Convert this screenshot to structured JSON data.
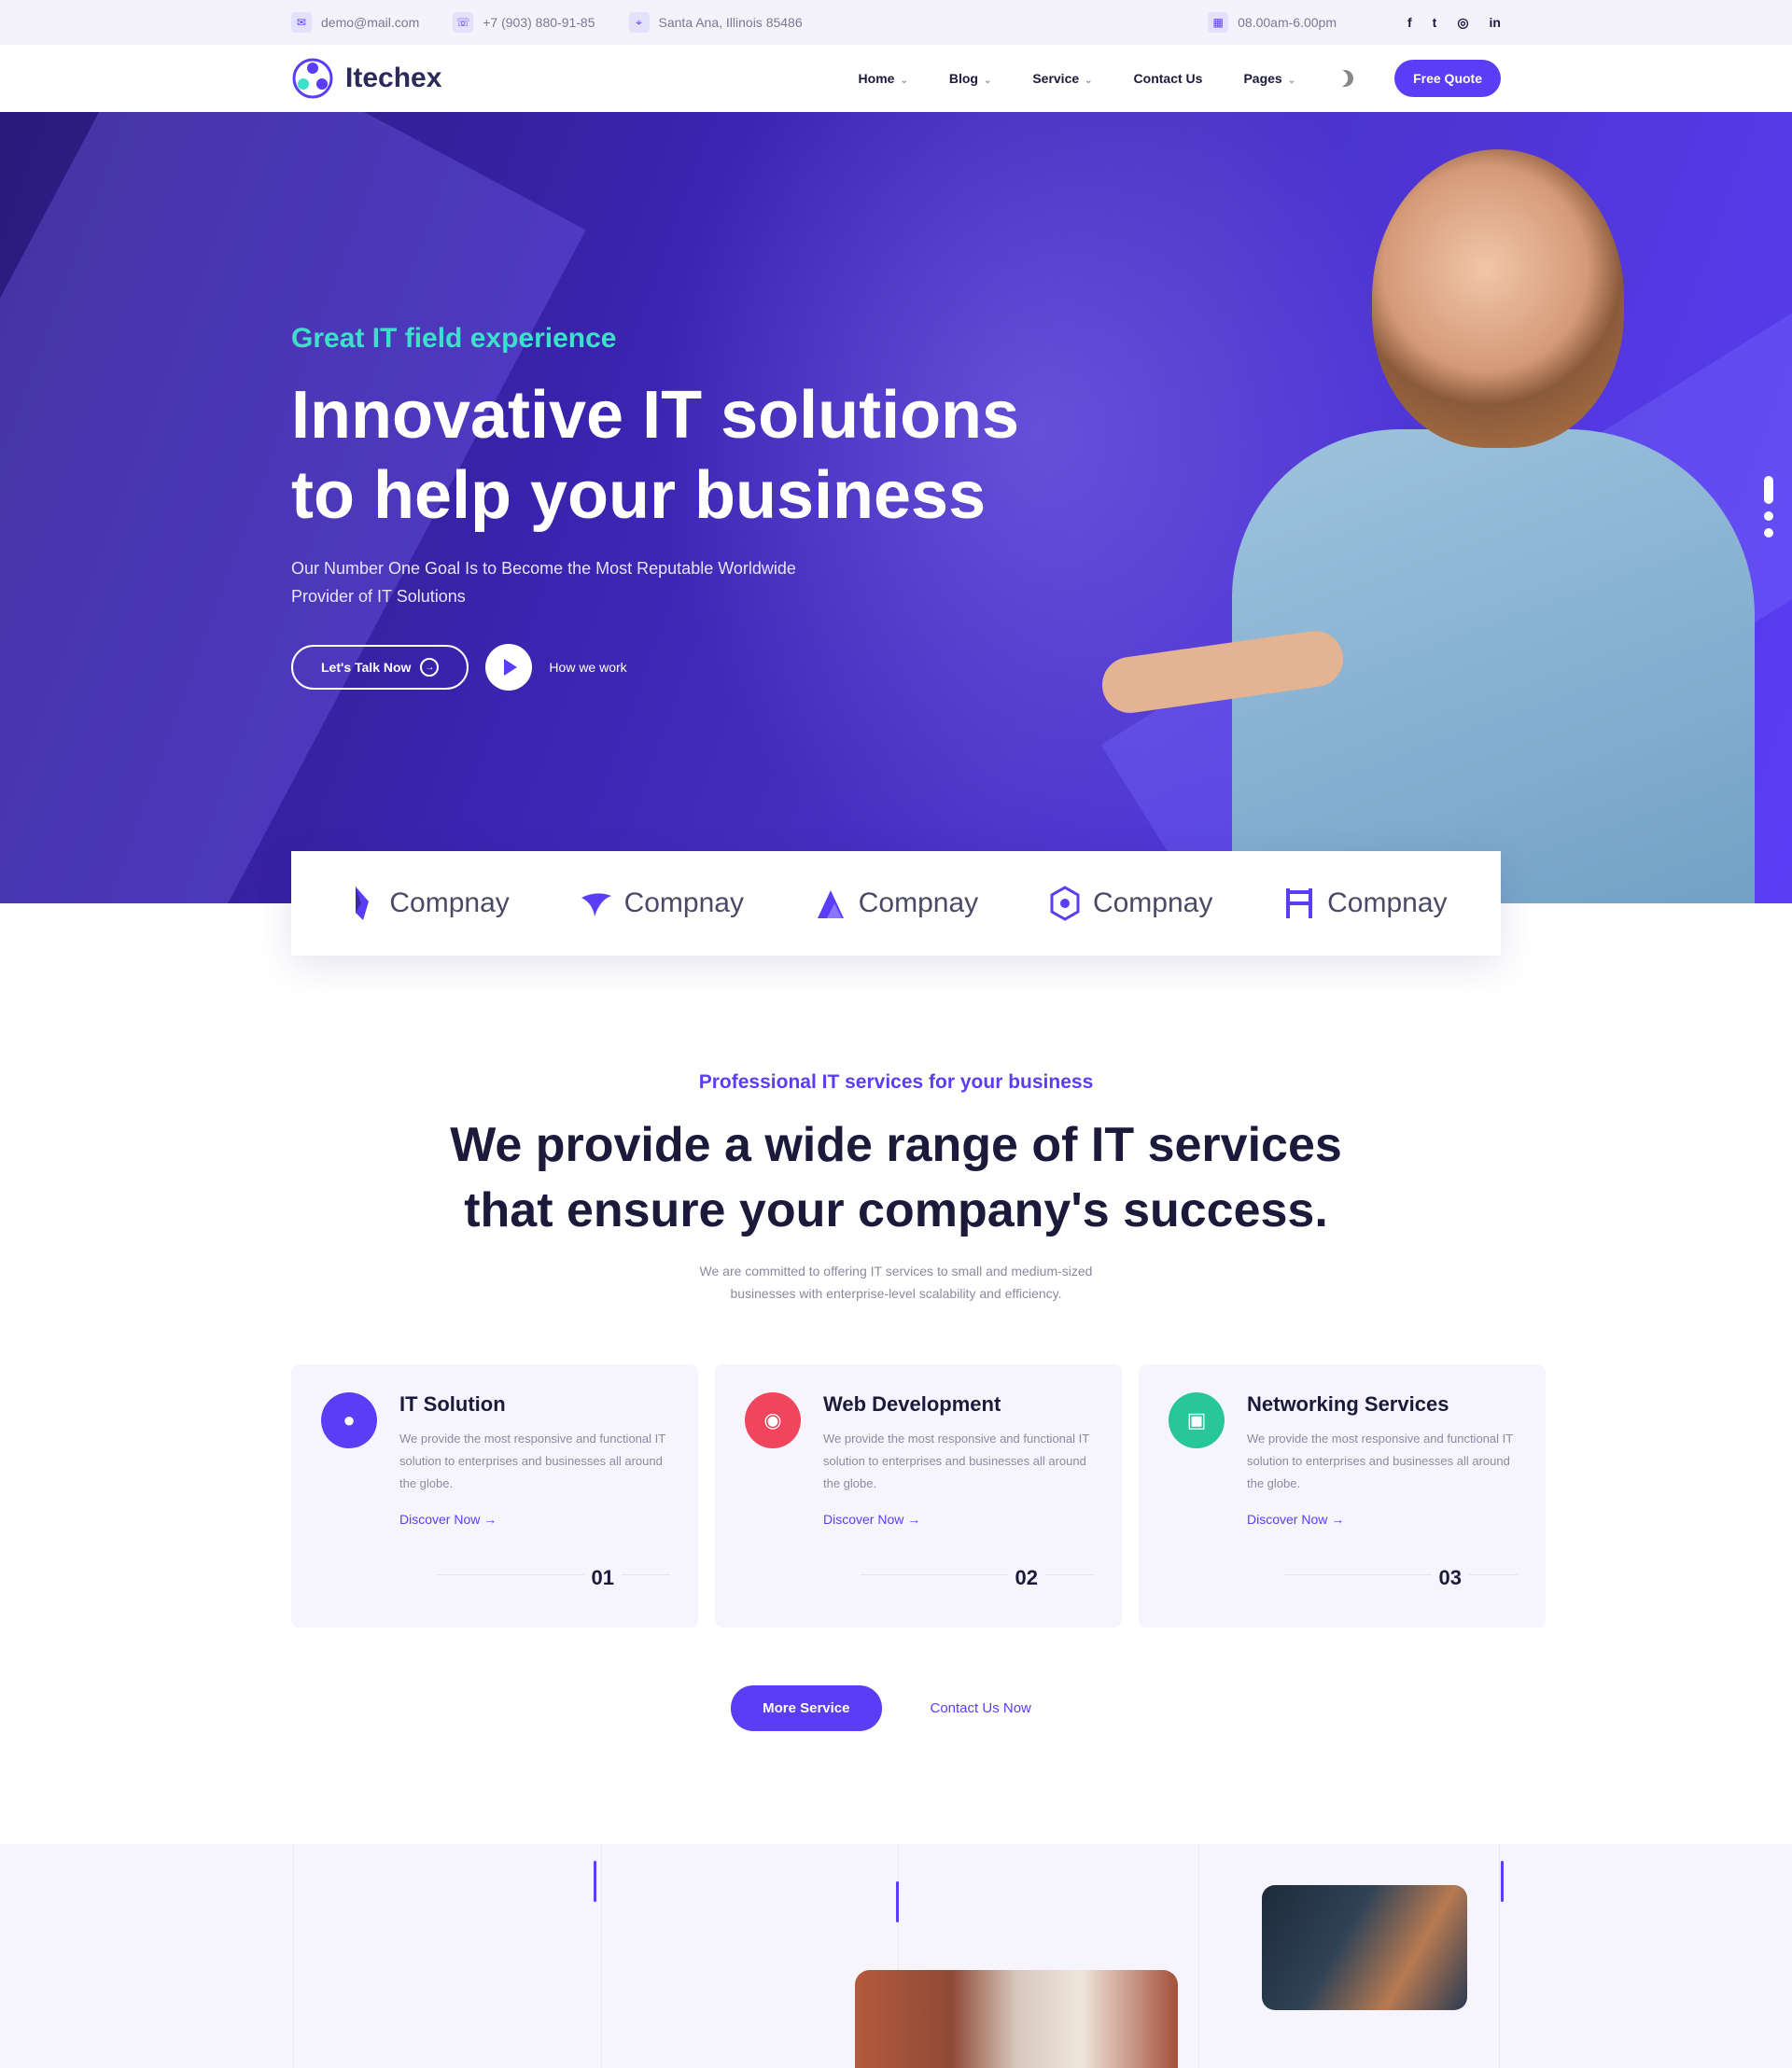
{
  "topbar": {
    "email": "demo@mail.com",
    "phone": "+7 (903) 880-91-85",
    "address": "Santa Ana, Illinois 85486",
    "hours": "08.00am-6.00pm",
    "socials": [
      "f",
      "t",
      "ig",
      "in"
    ]
  },
  "nav": {
    "logo": "Itechex",
    "items": [
      {
        "label": "Home",
        "dropdown": true
      },
      {
        "label": "Blog",
        "dropdown": true
      },
      {
        "label": "Service",
        "dropdown": true
      },
      {
        "label": "Contact Us",
        "dropdown": false
      },
      {
        "label": "Pages",
        "dropdown": true
      }
    ],
    "quote_button": "Free Quote"
  },
  "hero": {
    "subtitle": "Great IT field experience",
    "title_line1": "Innovative IT solutions",
    "title_line2": "to help your business",
    "desc_line1": "Our Number One Goal Is to Become the Most Reputable Worldwide",
    "desc_line2": "Provider of IT Solutions",
    "talk_button": "Let's Talk Now",
    "how_we_work": "How we work"
  },
  "brands": [
    "Compnay",
    "Compnay",
    "Compnay",
    "Compnay",
    "Compnay"
  ],
  "services": {
    "subtitle": "Professional IT services for your business",
    "title_line1": "We provide a wide range of IT services",
    "title_line2": "that ensure your company's success.",
    "desc_line1": "We are committed to offering IT services to small and medium-sized",
    "desc_line2": "businesses with enterprise-level scalability and efficiency.",
    "cards": [
      {
        "title": "IT Solution",
        "text": "We provide the most responsive and functional IT solution to enterprises and businesses all around the globe.",
        "link": "Discover Now",
        "number": "01",
        "color": "#5b3df5"
      },
      {
        "title": "Web Development",
        "text": "We provide the most responsive and functional IT solution to enterprises and businesses all around the globe.",
        "link": "Discover Now",
        "number": "02",
        "color": "#f0455c"
      },
      {
        "title": "Networking Services",
        "text": "We provide the most responsive and functional IT solution to enterprises and businesses all around the globe.",
        "link": "Discover Now",
        "number": "03",
        "color": "#28c79a"
      }
    ],
    "more_button": "More Service",
    "contact_button": "Contact Us Now"
  },
  "colors": {
    "accent": "#5b3df5",
    "teal": "#3de0c8",
    "dark": "#1b1a3a"
  }
}
